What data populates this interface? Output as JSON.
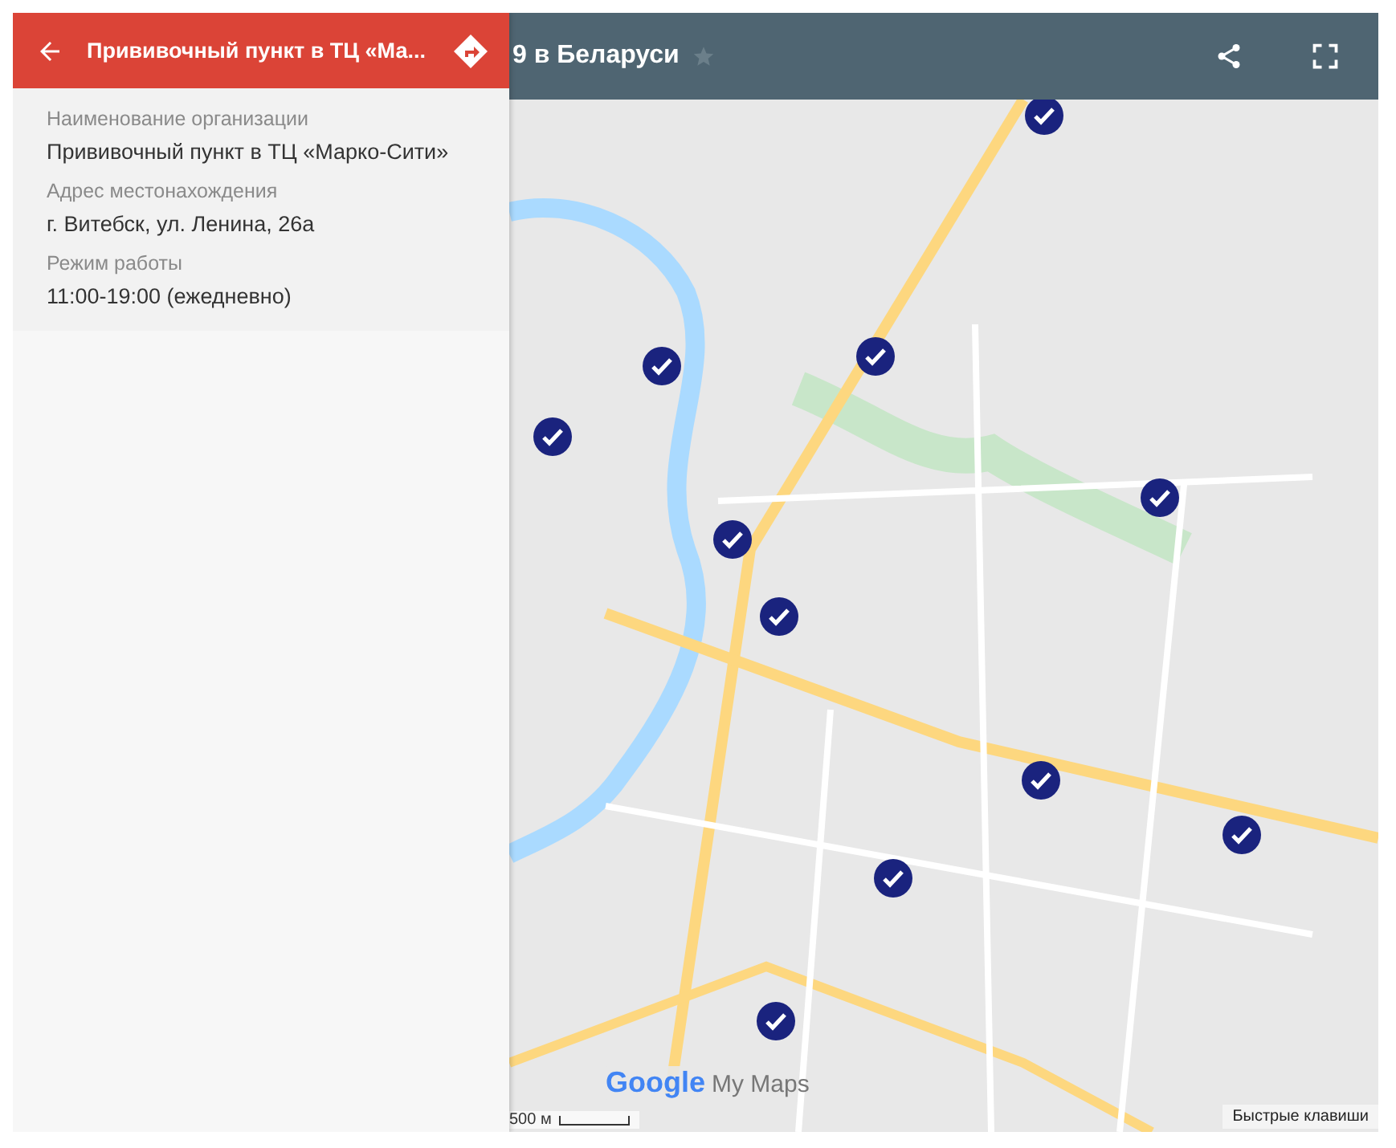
{
  "map_header": {
    "title": "9 в Беларуси",
    "starred": false
  },
  "panel": {
    "title": "Прививочный пункт в ТЦ «Ма...",
    "fields": [
      {
        "label": "Наименование организации",
        "value": "Прививочный пункт в ТЦ «Марко-Сити»"
      },
      {
        "label": "Адрес местонахождения",
        "value": "г. Витебск, ул. Ленина, 26а"
      },
      {
        "label": "Режим работы",
        "value": "11:00-19:00 (ежедневно)"
      }
    ]
  },
  "map": {
    "logo": "Google",
    "logo_suffix": "My Maps",
    "scale": "500 м",
    "shortcuts": "Быстрые клавиши"
  }
}
